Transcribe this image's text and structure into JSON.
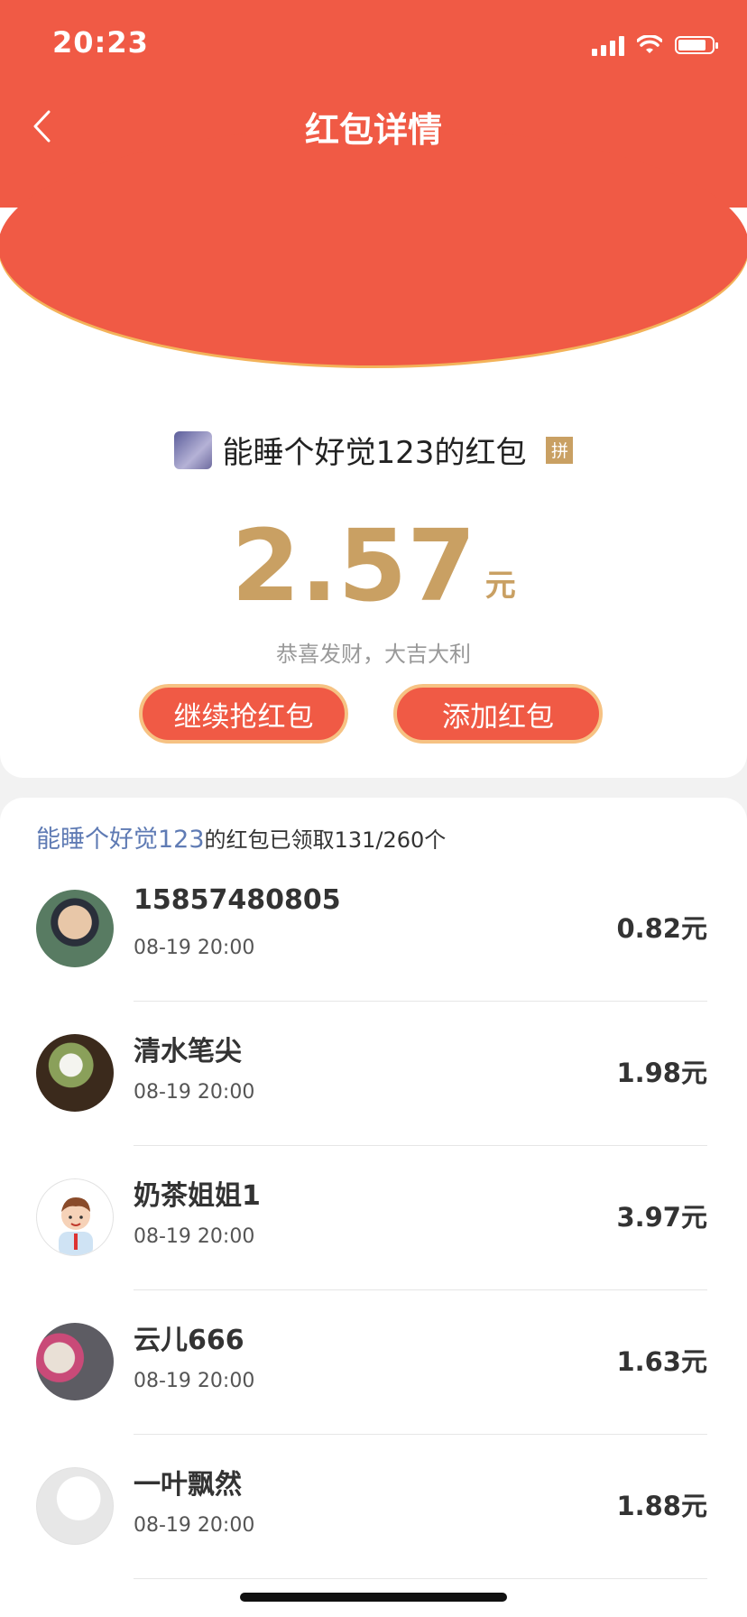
{
  "status_bar": {
    "time": "20:23"
  },
  "nav": {
    "title": "红包详情"
  },
  "packet": {
    "sender_title": "能睡个好觉123的红包",
    "badge": "拼",
    "amount": "2.57",
    "unit": "元",
    "blessing": "恭喜发财，大吉大利"
  },
  "buttons": {
    "continue_label": "继续抢红包",
    "add_label": "添加红包"
  },
  "summary": {
    "sender": "能睡个好觉123",
    "text": "的红包已领取131/260个"
  },
  "records": [
    {
      "name": "15857480805",
      "time": "08-19 20:00",
      "amount": "0.82元"
    },
    {
      "name": "清水笔尖",
      "time": "08-19 20:00",
      "amount": "1.98元"
    },
    {
      "name": "奶茶姐姐1",
      "time": "08-19 20:00",
      "amount": "3.97元"
    },
    {
      "name": "云儿666",
      "time": "08-19 20:00",
      "amount": "1.63元"
    },
    {
      "name": "一叶飘然",
      "time": "08-19 20:00",
      "amount": "1.88元"
    }
  ],
  "colors": {
    "brand_red": "#f05a45",
    "gold": "#c9a063",
    "link_blue": "#5f7bb4"
  },
  "icons": {
    "back": "chevron-left-icon",
    "signal": "cellular-signal-icon",
    "wifi": "wifi-icon",
    "battery": "battery-icon"
  }
}
